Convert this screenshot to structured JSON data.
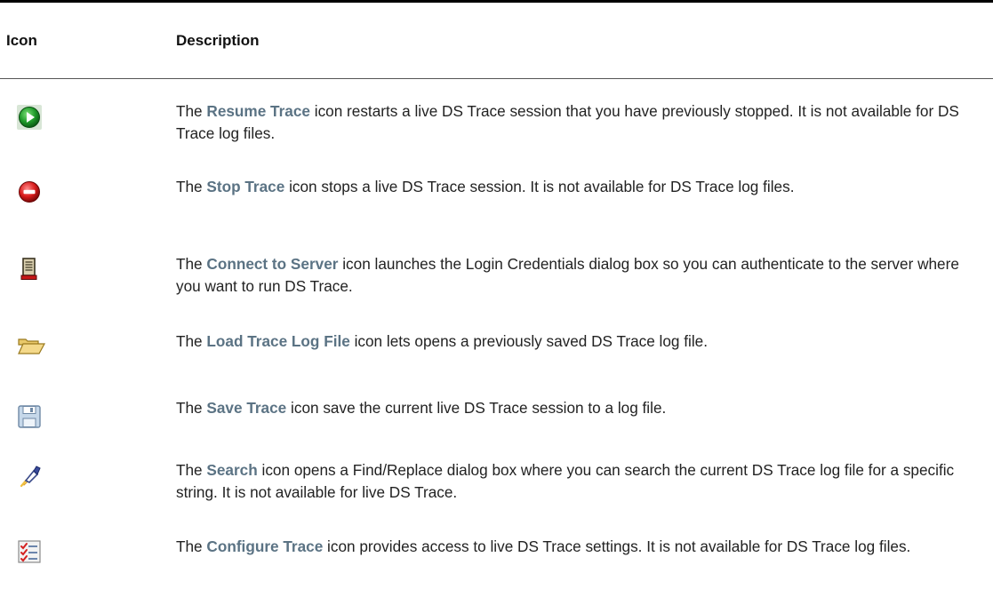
{
  "table": {
    "headers": {
      "icon": "Icon",
      "description": "Description"
    },
    "rows": [
      {
        "icon": "resume-trace-icon",
        "pre": "The ",
        "name": "Resume Trace",
        "post": " icon restarts a live DS Trace session that you have previously stopped. It is not available for DS Trace log files."
      },
      {
        "icon": "stop-trace-icon",
        "pre": "The ",
        "name": "Stop Trace",
        "post": " icon stops a live DS Trace session. It is not available for DS Trace log files."
      },
      {
        "icon": "connect-to-server-icon",
        "pre": "The ",
        "name": "Connect to Server",
        "post": " icon launches the Login Credentials dialog box so you can authenticate to the server where you want to run DS Trace."
      },
      {
        "icon": "load-trace-log-file-icon",
        "pre": "The ",
        "name": "Load Trace Log File",
        "post": " icon lets opens a previously saved DS Trace log file."
      },
      {
        "icon": "save-trace-icon",
        "pre": "The ",
        "name": "Save Trace",
        "post": " icon save the current live DS Trace session to a log file."
      },
      {
        "icon": "search-icon",
        "pre": "The ",
        "name": "Search",
        "post": " icon opens a Find/Replace dialog box where you can search the current DS Trace log file for a specific string. It is not available for live DS Trace."
      },
      {
        "icon": "configure-trace-icon",
        "pre": "The ",
        "name": "Configure Trace",
        "post": " icon provides access to live DS Trace settings. It is not available for DS Trace log files."
      }
    ]
  }
}
